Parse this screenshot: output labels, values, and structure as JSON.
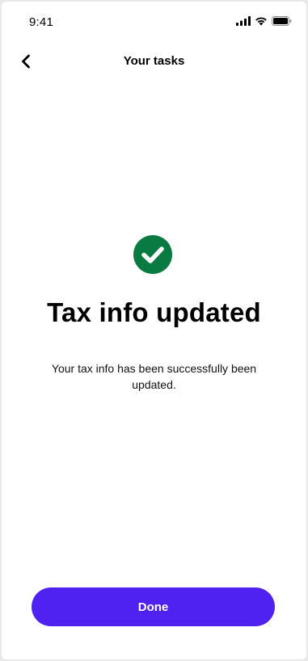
{
  "status_bar": {
    "time": "9:41",
    "icons": [
      "signal-icon",
      "wifi-icon",
      "battery-icon"
    ]
  },
  "nav": {
    "back_icon": "chevron-left-icon",
    "title": "Your tasks"
  },
  "content": {
    "icon": "check-circle-icon",
    "icon_color": "#0a7a43",
    "headline": "Tax info updated",
    "message": "Your tax info has been successfully been updated."
  },
  "actions": {
    "done_label": "Done",
    "done_color": "#4f22f2"
  }
}
